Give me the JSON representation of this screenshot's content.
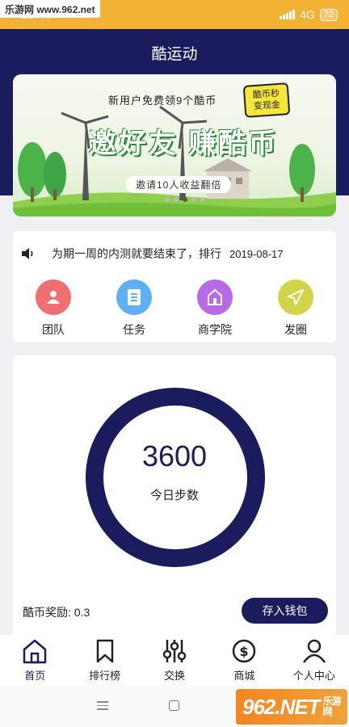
{
  "status_bar": {
    "time": "15:40",
    "network": "4G",
    "battery": "72"
  },
  "watermark_top": "乐游网 www.962.net",
  "header": {
    "title": "酷运动"
  },
  "banner": {
    "top_text": "新用户免费领9个酷币",
    "badge_line1": "酷币秒",
    "badge_line2": "变现金",
    "main_text": "邀好友  赚酷币",
    "pill_text": "邀请10人收益翻倍",
    "dot_count": 5,
    "active_dot": 2
  },
  "notice": {
    "text": "为期一周的内测就要结束了，排行",
    "date": "2019-08-17"
  },
  "menu": [
    {
      "label": "团队",
      "icon": "team-icon",
      "color": "#ef6f73"
    },
    {
      "label": "任务",
      "icon": "task-icon",
      "color": "#5fb0f3"
    },
    {
      "label": "商学院",
      "icon": "school-icon",
      "color": "#b86ae6"
    },
    {
      "label": "发圈",
      "icon": "send-icon",
      "color": "#d2d44a"
    }
  ],
  "steps": {
    "count": "3600",
    "label": "今日步数"
  },
  "reward": {
    "text": "酷币奖励: 0.3"
  },
  "deposit_button": "存入钱包",
  "bottom_nav": [
    {
      "label": "首页",
      "icon": "home-icon",
      "active": true
    },
    {
      "label": "排行榜",
      "icon": "bookmark-icon",
      "active": false
    },
    {
      "label": "交换",
      "icon": "sliders-icon",
      "active": false
    },
    {
      "label": "商城",
      "icon": "dollar-icon",
      "active": false
    },
    {
      "label": "个人中心",
      "icon": "user-icon",
      "active": false
    }
  ],
  "watermark_bottom": {
    "main": "962.NET",
    "sub": "乐游网"
  },
  "colors": {
    "primary": "#1b1c5e",
    "status_bar": "#f2b233"
  }
}
